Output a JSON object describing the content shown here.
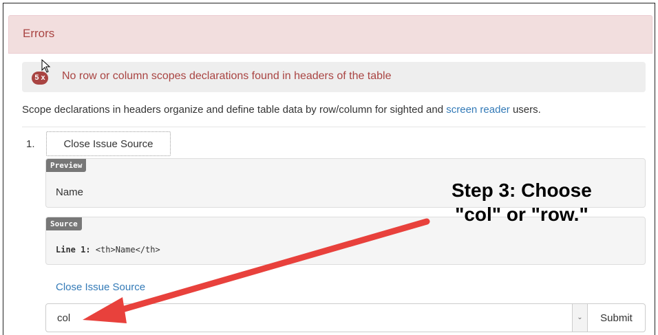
{
  "panel": {
    "title": "Errors"
  },
  "alert": {
    "count": "5 x",
    "text": "No row or column scopes declarations found in headers of the table"
  },
  "description": {
    "before": "Scope declarations in headers organize and define table data by row/column for sighted and ",
    "link": "screen reader",
    "after": " users."
  },
  "issue": {
    "number": "1.",
    "close_label": "Close Issue Source",
    "preview_tag": "Preview",
    "preview_text": "Name",
    "source_tag": "Source",
    "source_line_label": "Line 1:",
    "source_code": "<th>Name</th>",
    "close_link": "Close Issue Source"
  },
  "form": {
    "select_value": "col",
    "submit_label": "Submit"
  },
  "annotation": {
    "line1": "Step 3: Choose",
    "line2": "\"col\" or \"row.\""
  },
  "colors": {
    "error_bg": "#f2dede",
    "error_text": "#a94442",
    "link": "#337ab7",
    "arrow": "#e8413c"
  },
  "icons": [
    "mouse-pointer-icon",
    "chevron-down-icon",
    "annotation-arrow"
  ]
}
